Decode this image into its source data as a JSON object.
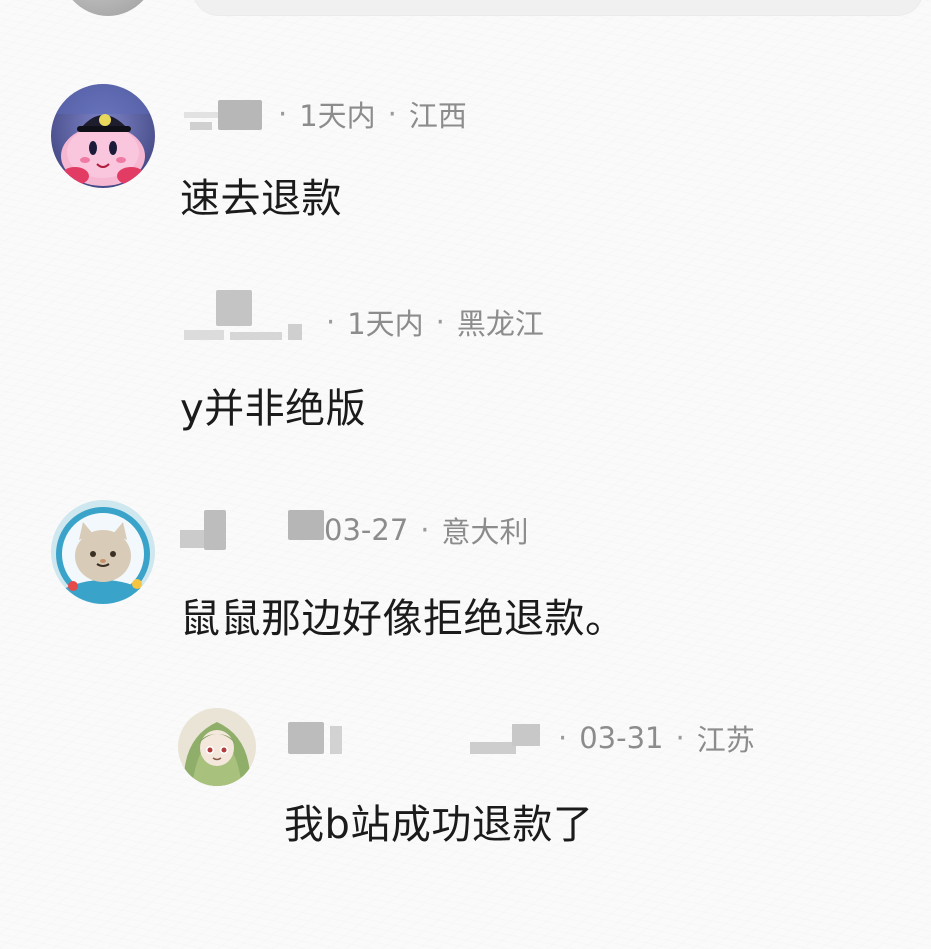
{
  "comments": [
    {
      "time": "1天内",
      "location": "江西",
      "content": "速去退款",
      "avatar_icon": "kirby-plush-avatar"
    },
    {
      "time": "1天内",
      "location": "黑龙江",
      "content": "y并非绝版",
      "avatar_icon": "none"
    },
    {
      "time": "03-27",
      "location": "意大利",
      "content": "鼠鼠那边好像拒绝退款。",
      "avatar_icon": "cat-astronaut-avatar"
    },
    {
      "time": "03-31",
      "location": "江苏",
      "content": "我b站成功退款了",
      "avatar_icon": "green-hair-girl-avatar",
      "is_reply": true
    }
  ],
  "separator": "·",
  "colors": {
    "meta_text": "#8c8c8c",
    "body_text": "#1b1b1b",
    "background": "#fafafa"
  }
}
